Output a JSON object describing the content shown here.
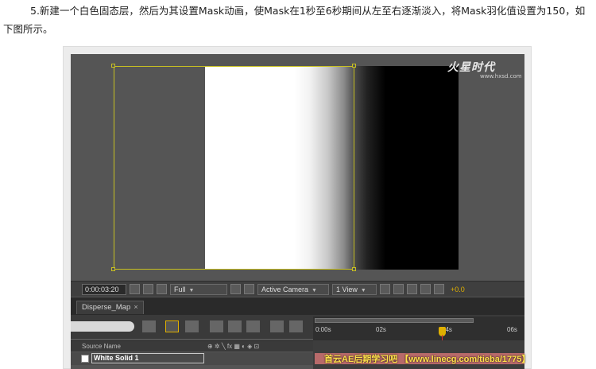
{
  "article": {
    "paragraph": "5.新建一个白色固态层，然后为其设置Mask动画，使Mask在1秒至6秒期间从左至右逐渐淡入，将Mask羽化值设置为150，如下图所示。"
  },
  "logo": {
    "name": "火星时代",
    "url": "www.hxsd.com"
  },
  "viewer_bar": {
    "timecode": "0:00:03:20",
    "resolution": "Full",
    "camera": "Active Camera",
    "views": "1 View",
    "exposure": "+0.0"
  },
  "timeline": {
    "tab_label": "Disperse_Map",
    "tab_close": "×",
    "ruler_labels": [
      "0:00s",
      "02s",
      "04s",
      "06s"
    ],
    "column_header": "Source Name",
    "layer_name": "White Solid 1",
    "header_switch_icons": "⊕ ✲ ╲ fx ▦ ◐ ◈ ⊡"
  },
  "watermark": "首云AE后期学习吧 【www.linecg.com/tieba/1775】",
  "colors": {
    "mask_outline": "#c8c021",
    "accent": "#e0b000",
    "cti_line": "#d63030"
  }
}
